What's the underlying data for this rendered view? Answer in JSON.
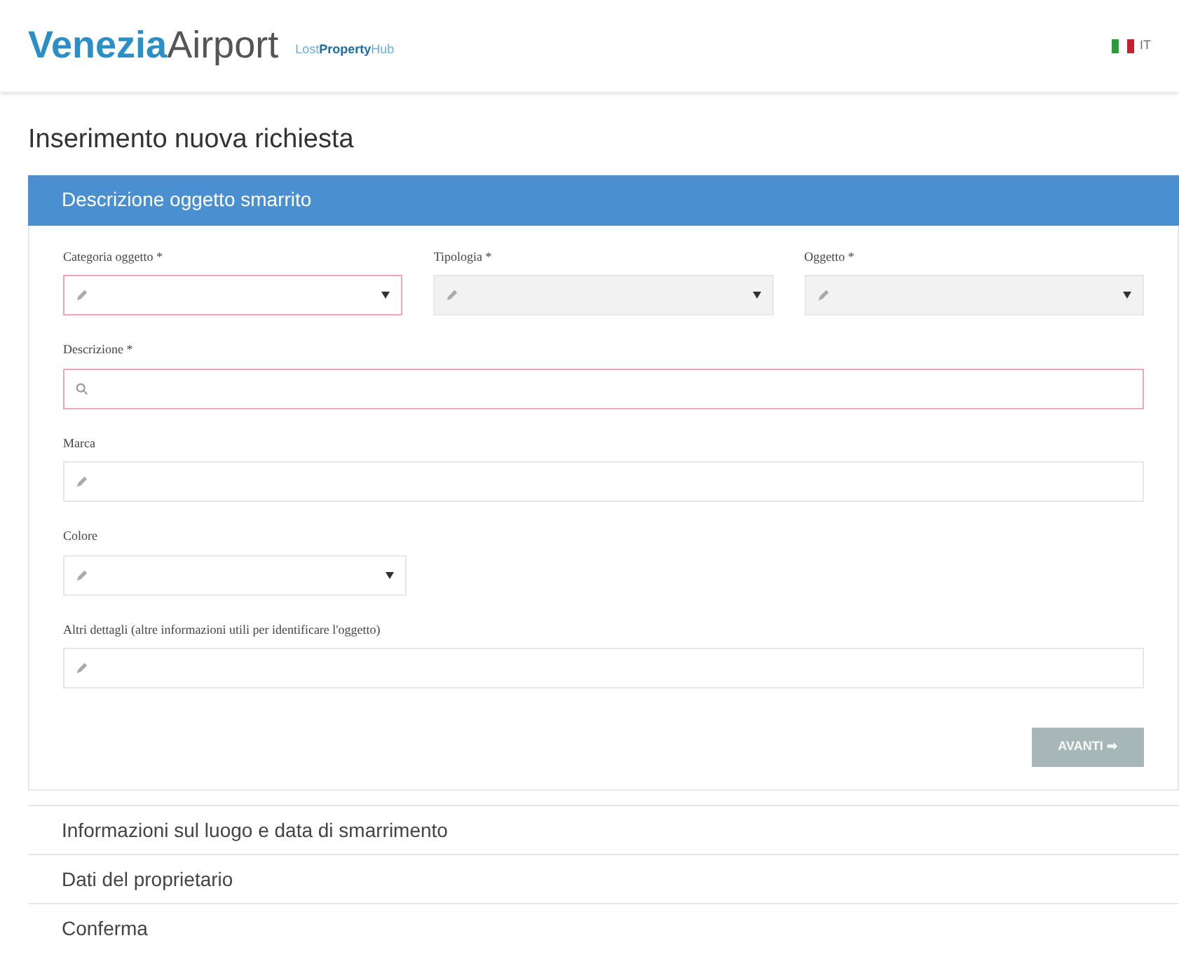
{
  "header": {
    "logo": {
      "primary": "Venezia",
      "secondary": "Airport"
    },
    "tagline": [
      {
        "text": "Lost",
        "accent": false
      },
      {
        "text": "Property",
        "accent": true
      },
      {
        "text": "Hub",
        "accent": false
      }
    ],
    "language": "IT"
  },
  "page_title": "Inserimento nuova richiesta",
  "sections": [
    {
      "title": "Descrizione oggetto smarrito",
      "expanded": true
    },
    {
      "title": "Informazioni sul luogo e data di smarrimento",
      "expanded": false
    },
    {
      "title": "Dati del proprietario",
      "expanded": false
    },
    {
      "title": "Conferma",
      "expanded": false
    }
  ],
  "form": {
    "rows": [
      [
        {
          "kind": "select",
          "label": "Categoria oggetto *",
          "invalid": true,
          "disabled": false
        },
        {
          "kind": "select",
          "label": "Tipologia *",
          "invalid": false,
          "disabled": true
        },
        {
          "kind": "select",
          "label": "Oggetto *",
          "invalid": false,
          "disabled": true
        }
      ],
      [
        {
          "kind": "search",
          "label": "Descrizione *",
          "invalid": true,
          "disabled": false
        }
      ],
      [
        {
          "kind": "text",
          "label": "Marca",
          "invalid": false,
          "disabled": false
        }
      ],
      [
        {
          "kind": "select",
          "label": "Colore",
          "invalid": false,
          "disabled": false,
          "narrow": true
        }
      ],
      [
        {
          "kind": "text",
          "label": "Altri dettagli (altre informazioni utili per identificare l'oggetto)",
          "invalid": false,
          "disabled": false
        }
      ]
    ],
    "next_button": {
      "label": "AVANTI ➡",
      "disabled": true
    }
  }
}
